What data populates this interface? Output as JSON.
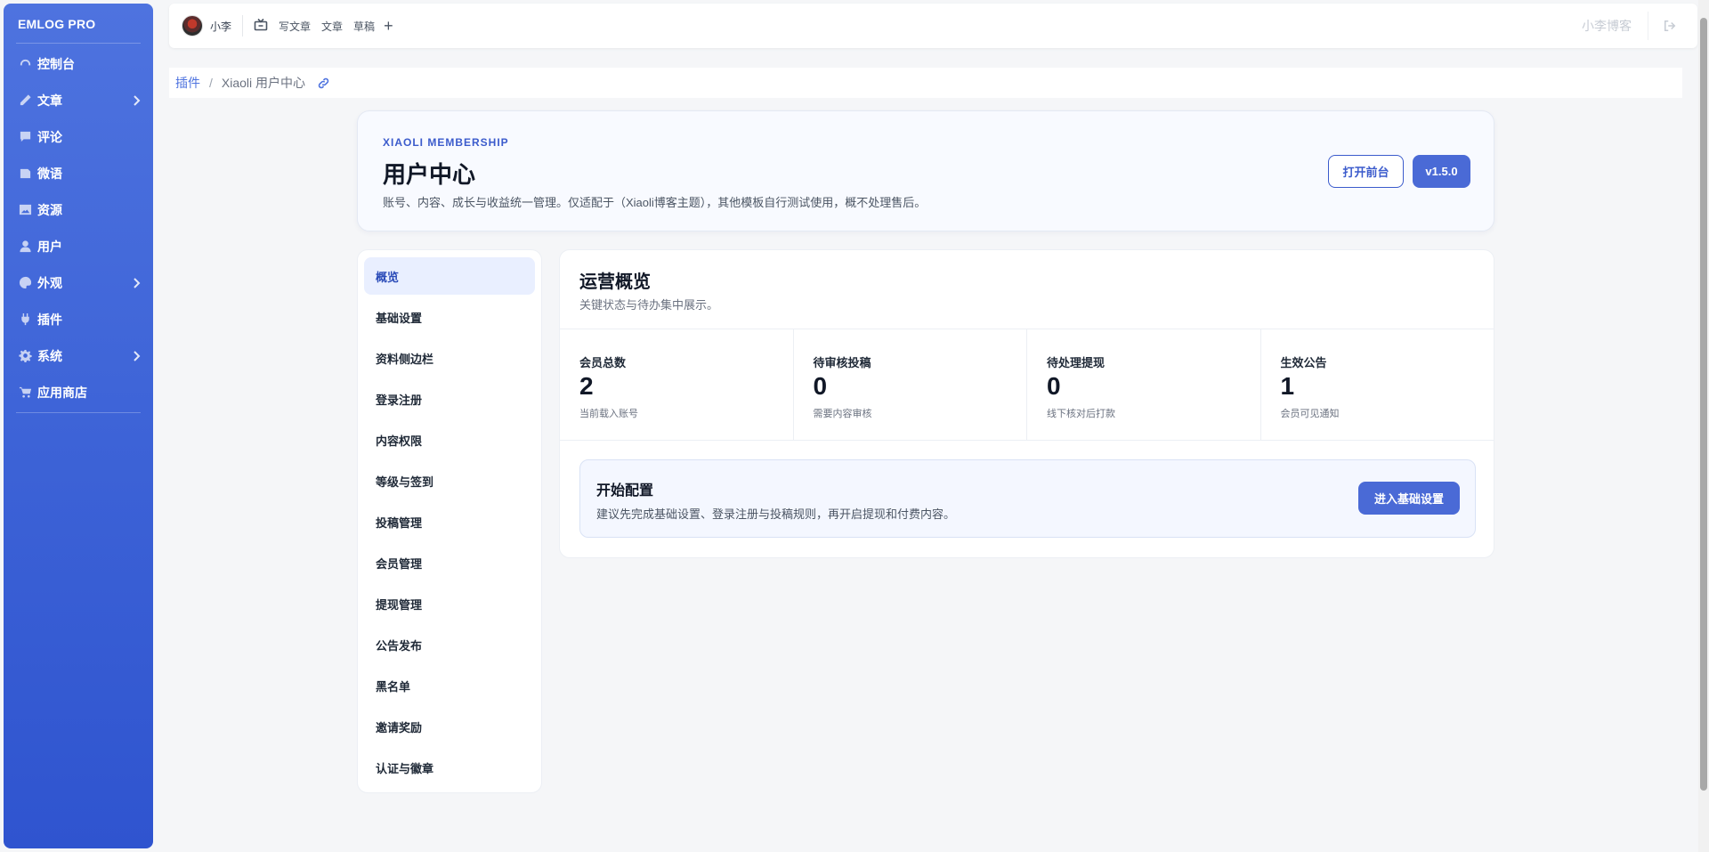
{
  "sidebar": {
    "brand": "EMLOG PRO",
    "items": [
      {
        "label": "控制台",
        "icon": "dashboard-icon",
        "chevron": false
      },
      {
        "label": "文章",
        "icon": "pencil-icon",
        "chevron": true
      },
      {
        "label": "评论",
        "icon": "comment-icon",
        "chevron": false
      },
      {
        "label": "微语",
        "icon": "note-icon",
        "chevron": false
      },
      {
        "label": "资源",
        "icon": "image-icon",
        "chevron": false
      },
      {
        "label": "用户",
        "icon": "user-icon",
        "chevron": false
      },
      {
        "label": "外观",
        "icon": "palette-icon",
        "chevron": true
      },
      {
        "label": "插件",
        "icon": "plug-icon",
        "chevron": false
      },
      {
        "label": "系统",
        "icon": "gear-icon",
        "chevron": true
      },
      {
        "label": "应用商店",
        "icon": "cart-icon",
        "chevron": false
      }
    ]
  },
  "topbar": {
    "username": "小李",
    "links": [
      "写文章",
      "文章",
      "草稿"
    ],
    "plus": "+",
    "site_name": "小李博客"
  },
  "breadcrumb": {
    "parent": "插件",
    "separator": "/",
    "current": "Xiaoli 用户中心"
  },
  "hero": {
    "eyebrow": "XIAOLI MEMBERSHIP",
    "title": "用户中心",
    "description": "账号、内容、成长与收益统一管理。仅适配于（Xiaoli博客主题），其他模板自行测试使用，概不处理售后。",
    "open_frontend": "打开前台",
    "version": "v1.5.0"
  },
  "submenu": {
    "active_index": 0,
    "items": [
      "概览",
      "基础设置",
      "资料侧边栏",
      "登录注册",
      "内容权限",
      "等级与签到",
      "投稿管理",
      "会员管理",
      "提现管理",
      "公告发布",
      "黑名单",
      "邀请奖励",
      "认证与徽章"
    ]
  },
  "overview": {
    "title": "运营概览",
    "subtitle": "关键状态与待办集中展示。",
    "stats": [
      {
        "label": "会员总数",
        "value": "2",
        "hint": "当前载入账号"
      },
      {
        "label": "待审核投稿",
        "value": "0",
        "hint": "需要内容审核"
      },
      {
        "label": "待处理提现",
        "value": "0",
        "hint": "线下核对后打款"
      },
      {
        "label": "生效公告",
        "value": "1",
        "hint": "会员可见通知"
      }
    ],
    "setup": {
      "title": "开始配置",
      "description": "建议先完成基础设置、登录注册与投稿规则，再开启提现和付费内容。",
      "button": "进入基础设置"
    }
  },
  "colors": {
    "accent": "#4a6ad6",
    "sidebar_top": "#4e73df",
    "sidebar_bottom": "#2f54cf"
  }
}
